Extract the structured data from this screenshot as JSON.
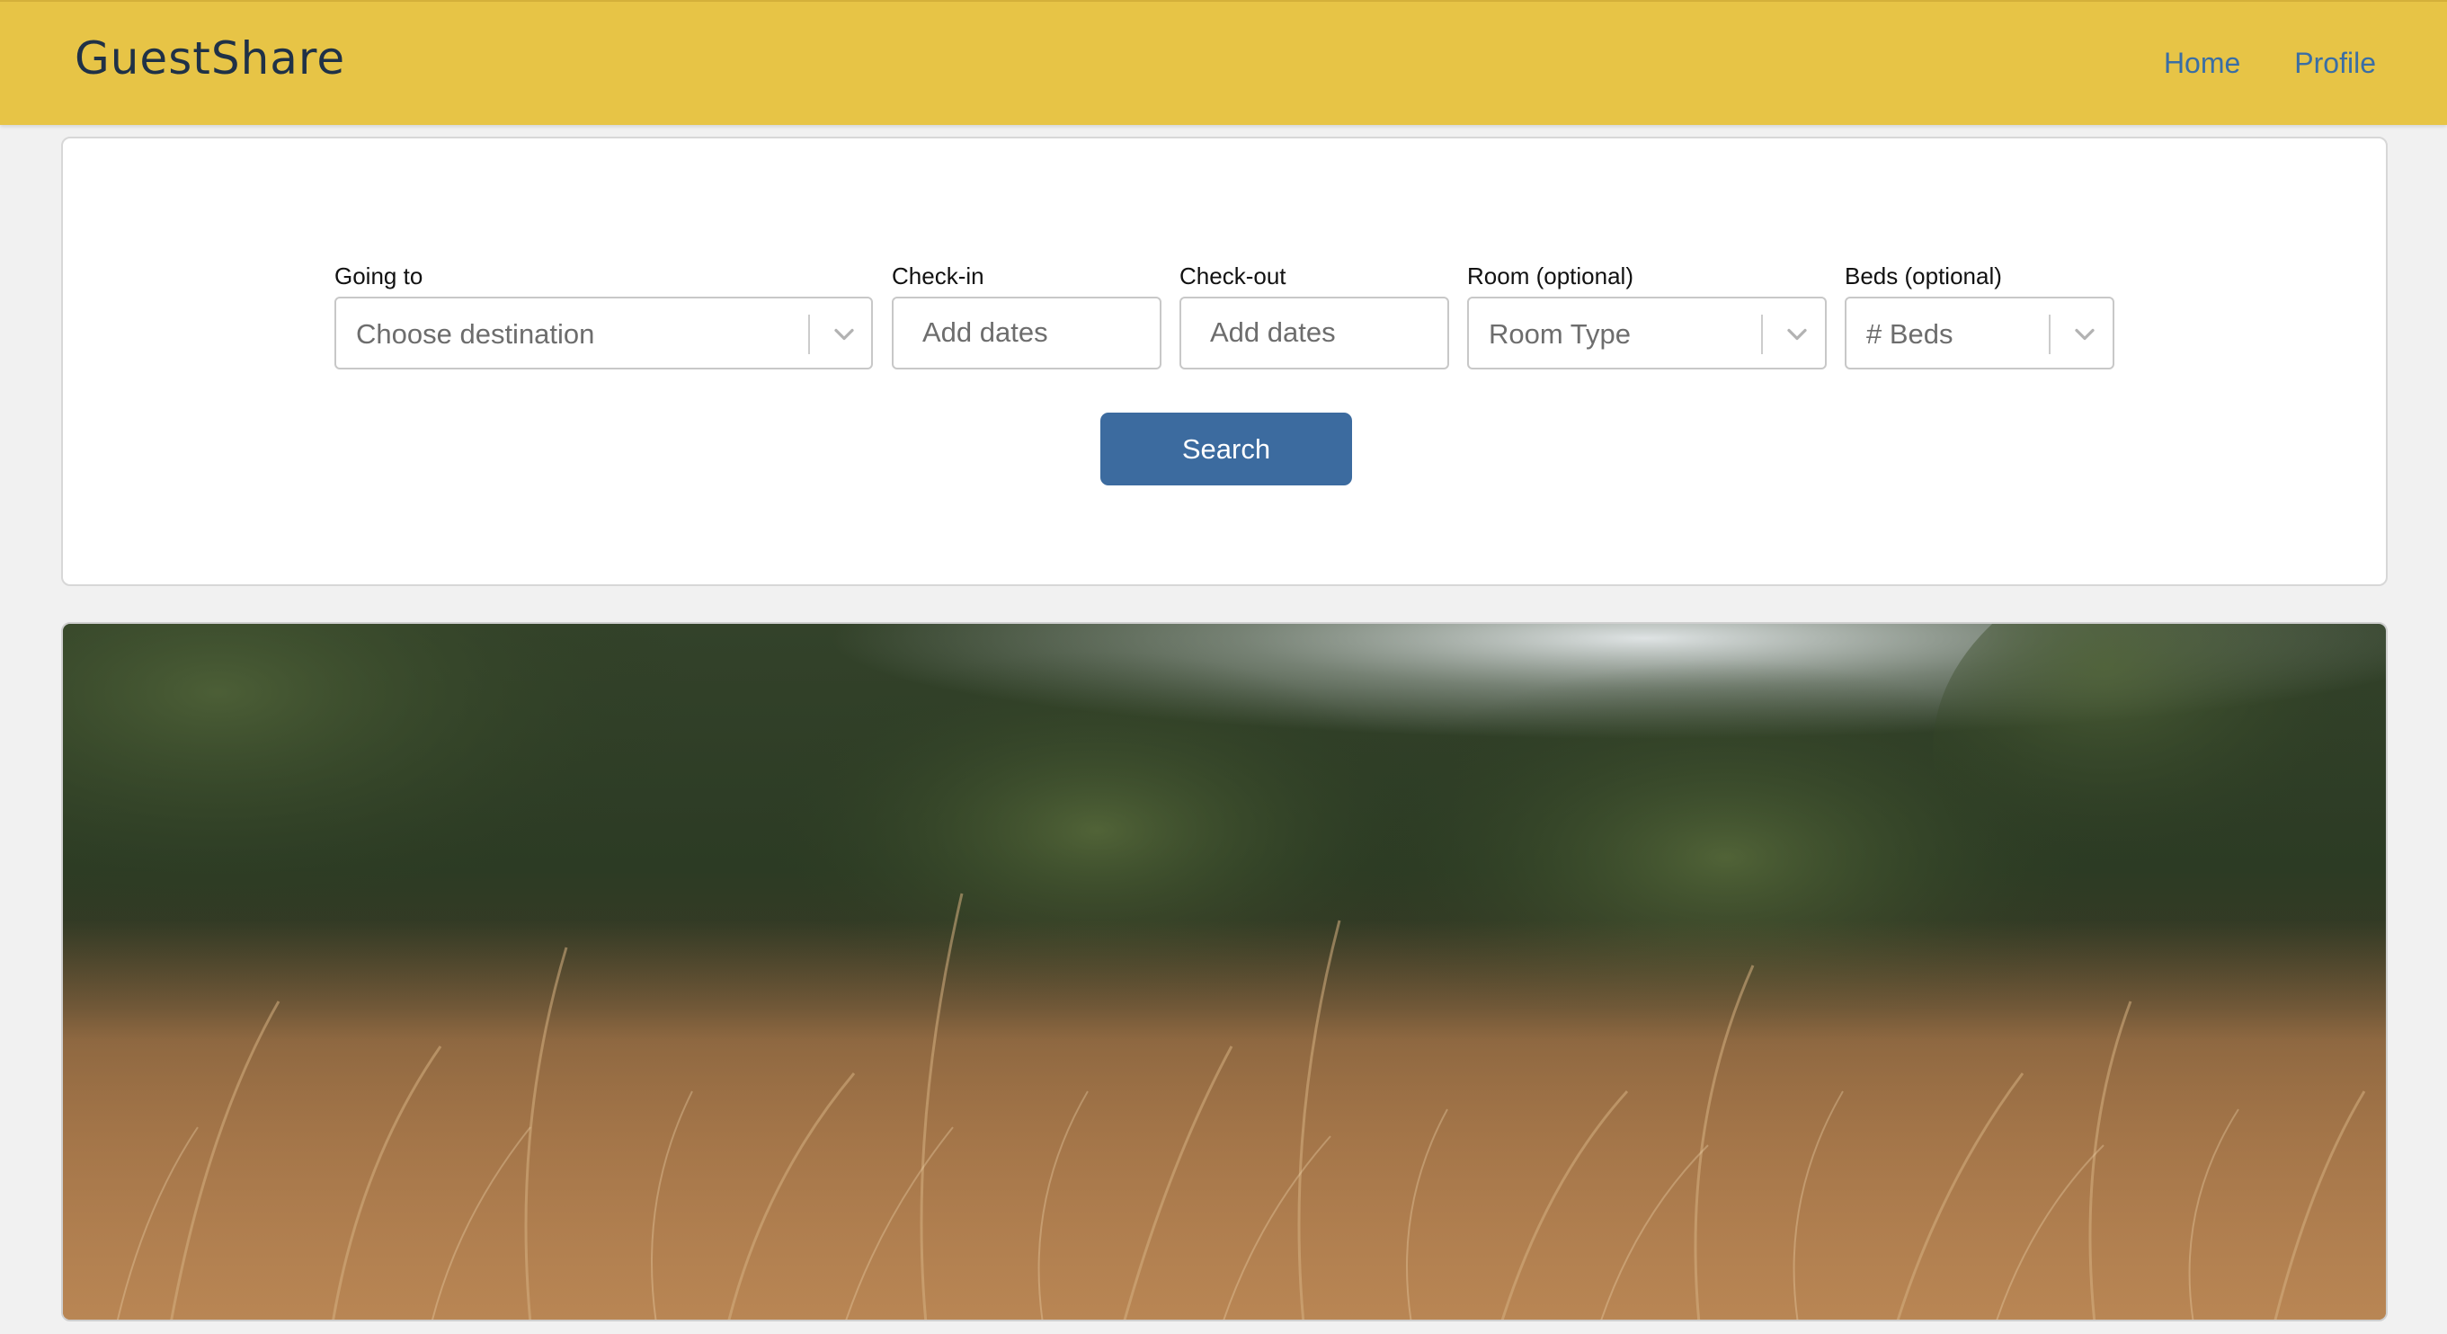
{
  "header": {
    "brand": "GuestShare",
    "nav": [
      {
        "label": "Home"
      },
      {
        "label": "Profile"
      }
    ]
  },
  "search": {
    "going_to": {
      "label": "Going to",
      "placeholder": "Choose destination"
    },
    "check_in": {
      "label": "Check-in",
      "placeholder": "Add dates"
    },
    "check_out": {
      "label": "Check-out",
      "placeholder": "Add dates"
    },
    "room": {
      "label": "Room (optional)",
      "placeholder": "Room Type"
    },
    "beds": {
      "label": "Beds (optional)",
      "placeholder": "# Beds"
    },
    "button_label": "Search"
  },
  "icons": {
    "dropdown": "chevron-down-icon"
  },
  "colors": {
    "header_bg": "#e7c446",
    "brand_text": "#1f3147",
    "nav_link": "#3a6ea5",
    "button_bg": "#3c6b9f"
  }
}
